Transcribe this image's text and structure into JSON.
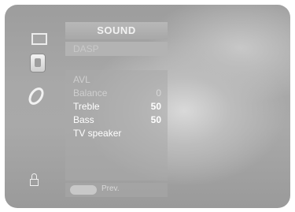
{
  "menu": {
    "title": "SOUND",
    "dasp_label": "DASP",
    "items": [
      {
        "label": "AVL",
        "value": ""
      },
      {
        "label": "Balance",
        "value": "0"
      },
      {
        "label": "Treble",
        "value": "50"
      },
      {
        "label": "Bass",
        "value": "50"
      },
      {
        "label": "TV speaker",
        "value": ""
      }
    ]
  },
  "footer": {
    "prev_label": "Prev."
  },
  "icons": [
    "tv-picture-icon",
    "sound-icon",
    "setup-icon",
    "lock-icon"
  ]
}
